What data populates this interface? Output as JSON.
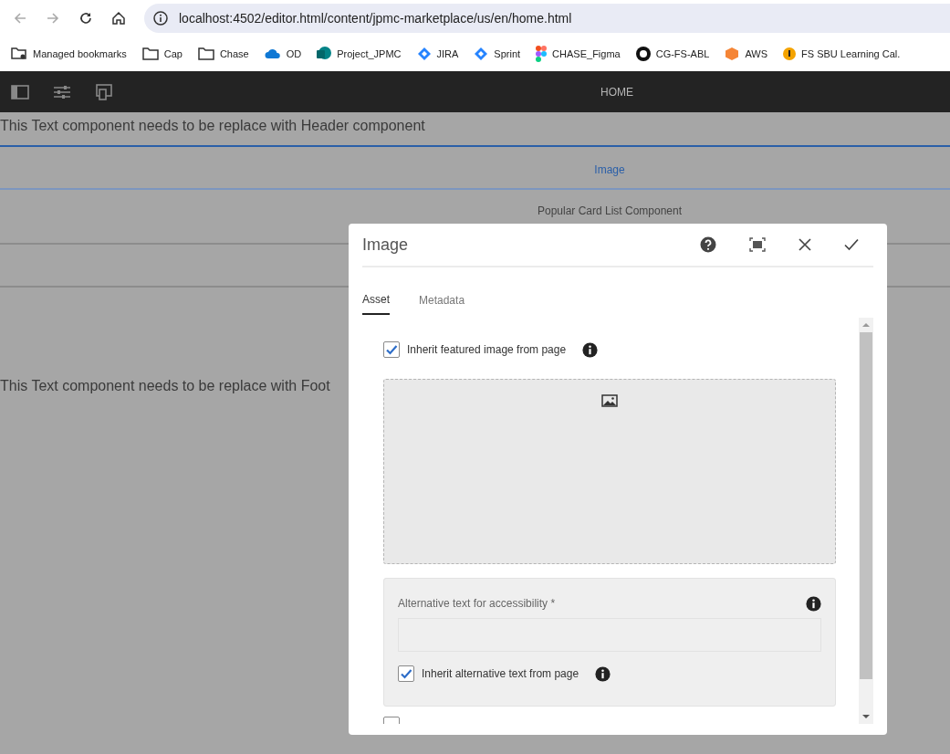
{
  "browser": {
    "url": "localhost:4502/editor.html/content/jpmc-marketplace/us/en/home.html",
    "bookmarks": [
      {
        "label": "Managed bookmarks",
        "kind": "managed"
      },
      {
        "label": "Cap",
        "kind": "folder"
      },
      {
        "label": "Chase",
        "kind": "folder"
      },
      {
        "label": "OD",
        "kind": "cloud"
      },
      {
        "label": "Project_JPMC",
        "kind": "sharepoint"
      },
      {
        "label": "JIRA",
        "kind": "jira"
      },
      {
        "label": "Sprint",
        "kind": "jira"
      },
      {
        "label": "CHASE_Figma",
        "kind": "figma"
      },
      {
        "label": "CG-FS-ABL",
        "kind": "github"
      },
      {
        "label": "AWS",
        "kind": "aws"
      },
      {
        "label": "FS SBU Learning Cal.",
        "kind": "learning"
      }
    ]
  },
  "editor": {
    "title": "HOME"
  },
  "page": {
    "header_text": "This Text component needs to be replace with Header component",
    "components": [
      {
        "label": "Image",
        "selected": true
      },
      {
        "label": "Popular Card List Component",
        "selected": false
      },
      {
        "selected": false
      }
    ],
    "footer_text": "This Text component needs to be replace with Foot"
  },
  "dialog": {
    "title": "Image",
    "tabs": [
      {
        "label": "Asset",
        "selected": true
      },
      {
        "label": "Metadata",
        "selected": false
      }
    ],
    "inherit_featured": {
      "label": "Inherit featured image from page",
      "checked": true
    },
    "alt_text": {
      "label": "Alternative text for accessibility *"
    },
    "inherit_alt": {
      "label": "Inherit alternative text from page",
      "checked": true
    },
    "no_alt": {
      "checked": false
    }
  }
}
